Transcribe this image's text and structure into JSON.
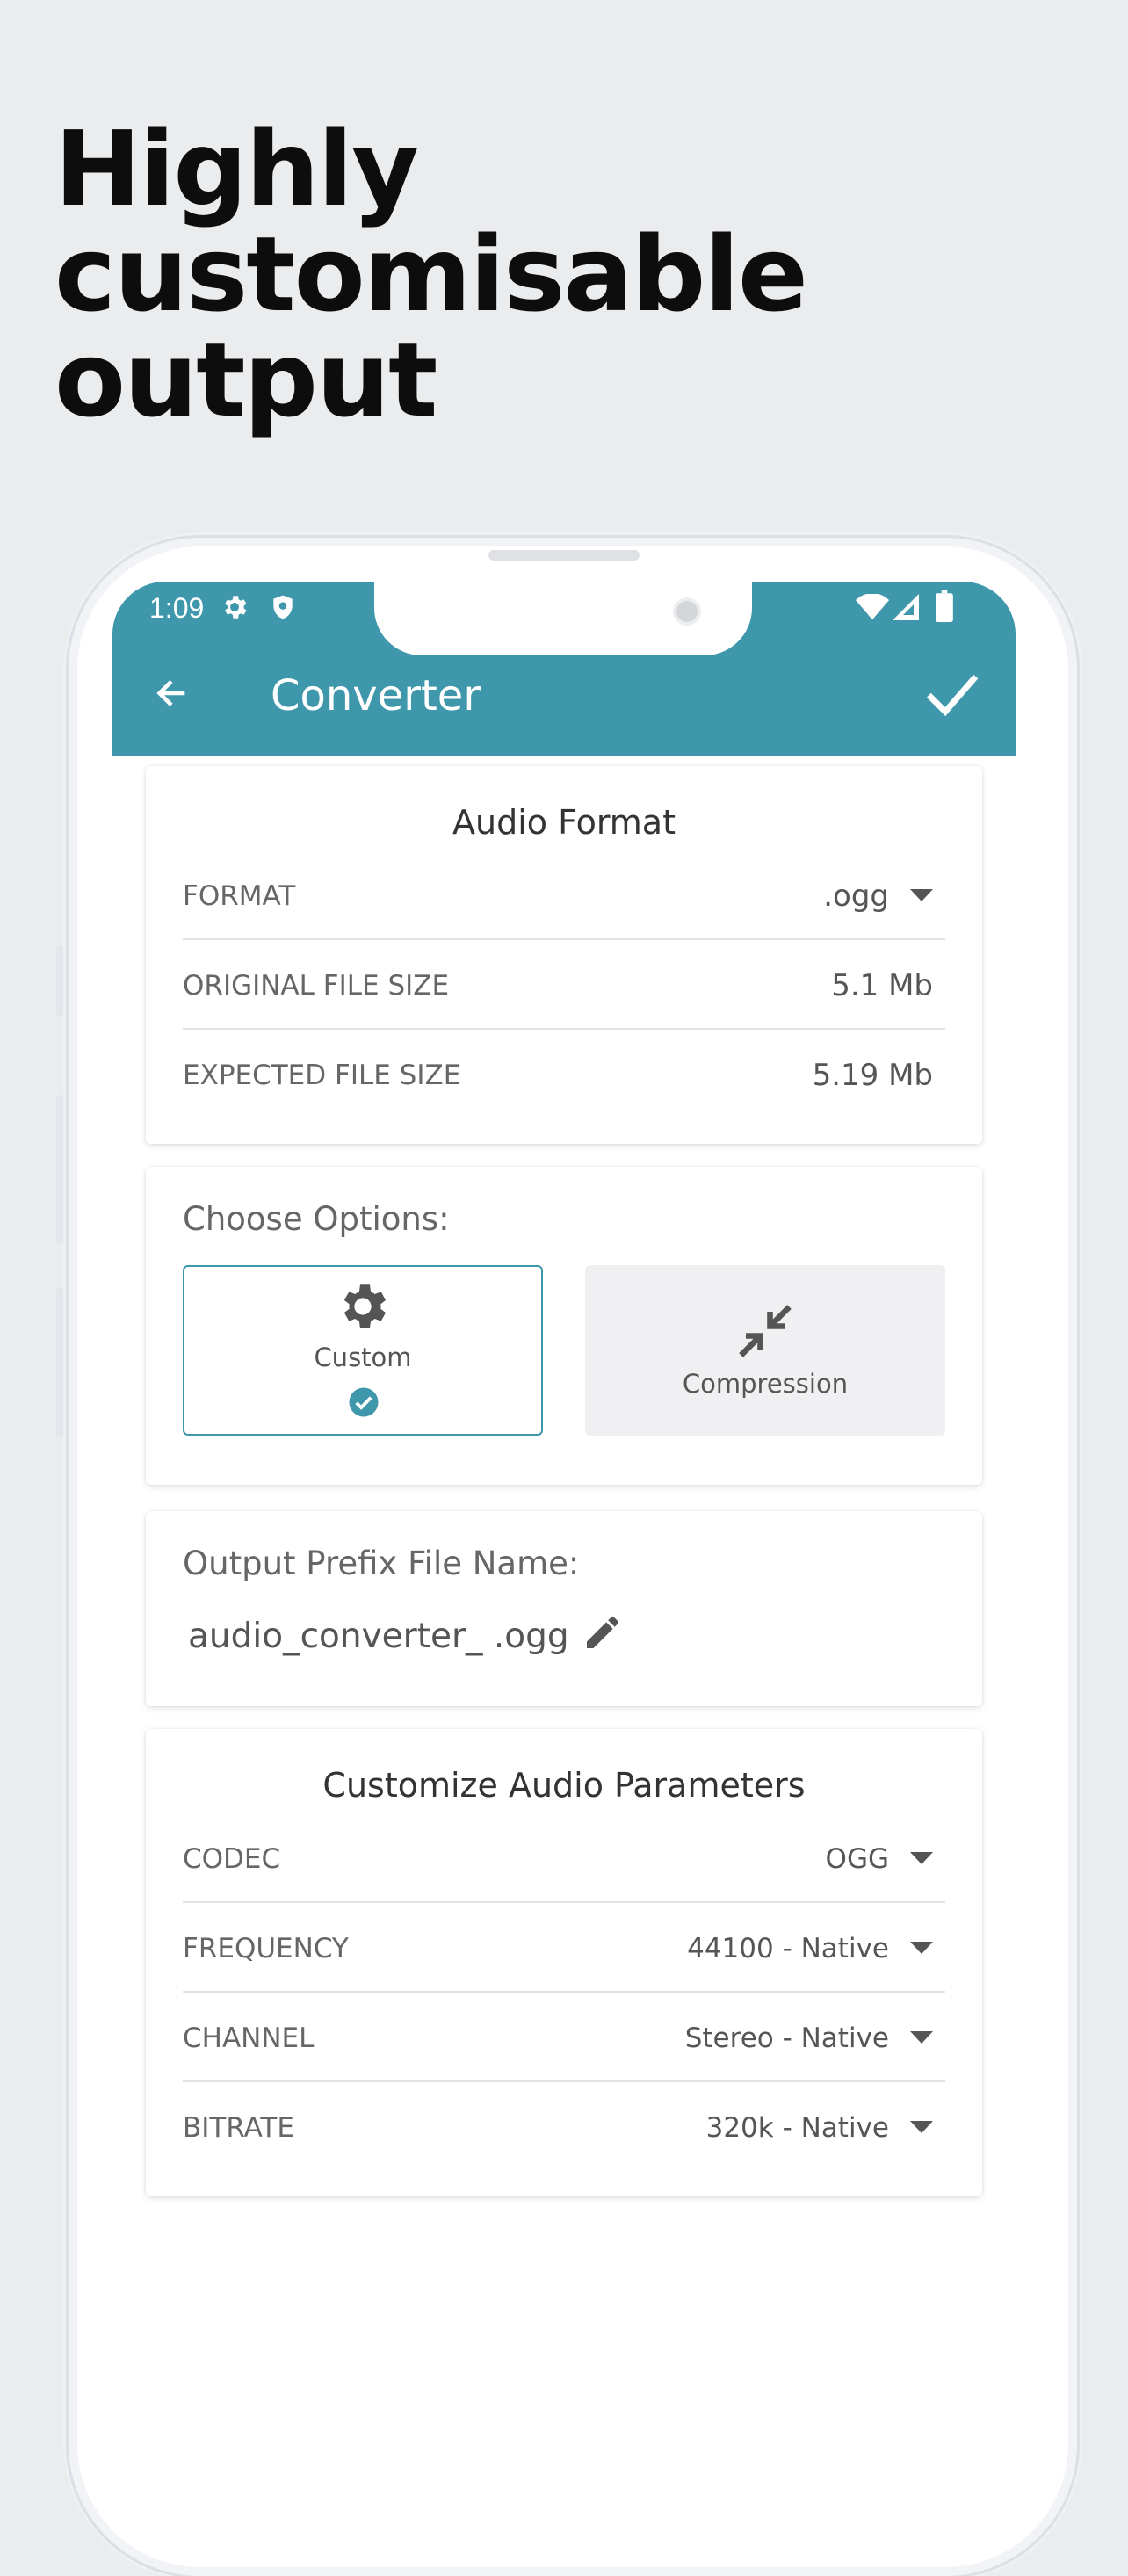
{
  "headline": "Highly customisable output",
  "status": {
    "time": "1:09"
  },
  "appbar": {
    "title": "Converter"
  },
  "audio_format": {
    "title": "Audio Format",
    "rows": [
      {
        "label": "FORMAT",
        "value": ".ogg"
      },
      {
        "label": "ORIGINAL FILE SIZE",
        "value": "5.1 Mb"
      },
      {
        "label": "EXPECTED FILE SIZE",
        "value": "5.19 Mb"
      }
    ]
  },
  "options": {
    "title": "Choose Options:",
    "custom_label": "Custom",
    "compression_label": "Compression"
  },
  "prefix": {
    "title": "Output Prefix File Name:",
    "value": "audio_converter_ .ogg"
  },
  "params": {
    "title": "Customize Audio Parameters",
    "rows": [
      {
        "label": "CODEC",
        "value": "OGG"
      },
      {
        "label": "FREQUENCY",
        "value": "44100 - Native"
      },
      {
        "label": "CHANNEL",
        "value": "Stereo - Native"
      },
      {
        "label": "BITRATE",
        "value": "320k - Native"
      }
    ]
  },
  "colors": {
    "accent": "#3e97aa",
    "background": "#ebecee"
  },
  "icons": [
    "settings-icon",
    "shield-icon",
    "wifi-icon",
    "signal-icon",
    "battery-icon",
    "back-arrow-icon",
    "check-icon",
    "dropdown-caret-icon",
    "gear-icon",
    "check-circle-icon",
    "compress-icon",
    "pencil-icon"
  ]
}
